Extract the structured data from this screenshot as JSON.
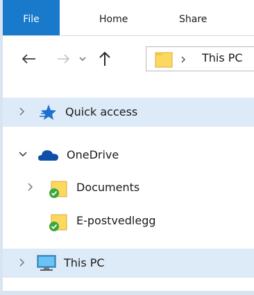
{
  "ribbon": {
    "tabs": [
      "File",
      "Home",
      "Share"
    ]
  },
  "address_bar": {
    "path": "This PC"
  },
  "nav_tree": {
    "items": [
      {
        "label": "Quick access",
        "icon": "star-icon",
        "expander": "collapsed",
        "selected": true
      },
      {
        "label": "OneDrive",
        "icon": "cloud-icon",
        "expander": "expanded",
        "selected": false
      },
      {
        "label": "Documents",
        "icon": "folder-synced-icon",
        "expander": "collapsed",
        "selected": false
      },
      {
        "label": "E-postvedlegg",
        "icon": "folder-synced-icon",
        "expander": "none",
        "selected": false
      },
      {
        "label": "This PC",
        "icon": "computer-icon",
        "expander": "collapsed",
        "selected": true
      }
    ]
  },
  "colors": {
    "file_tab": "#1979ca",
    "selection": "#ddeaf7",
    "frame": "#d9e4f1"
  }
}
